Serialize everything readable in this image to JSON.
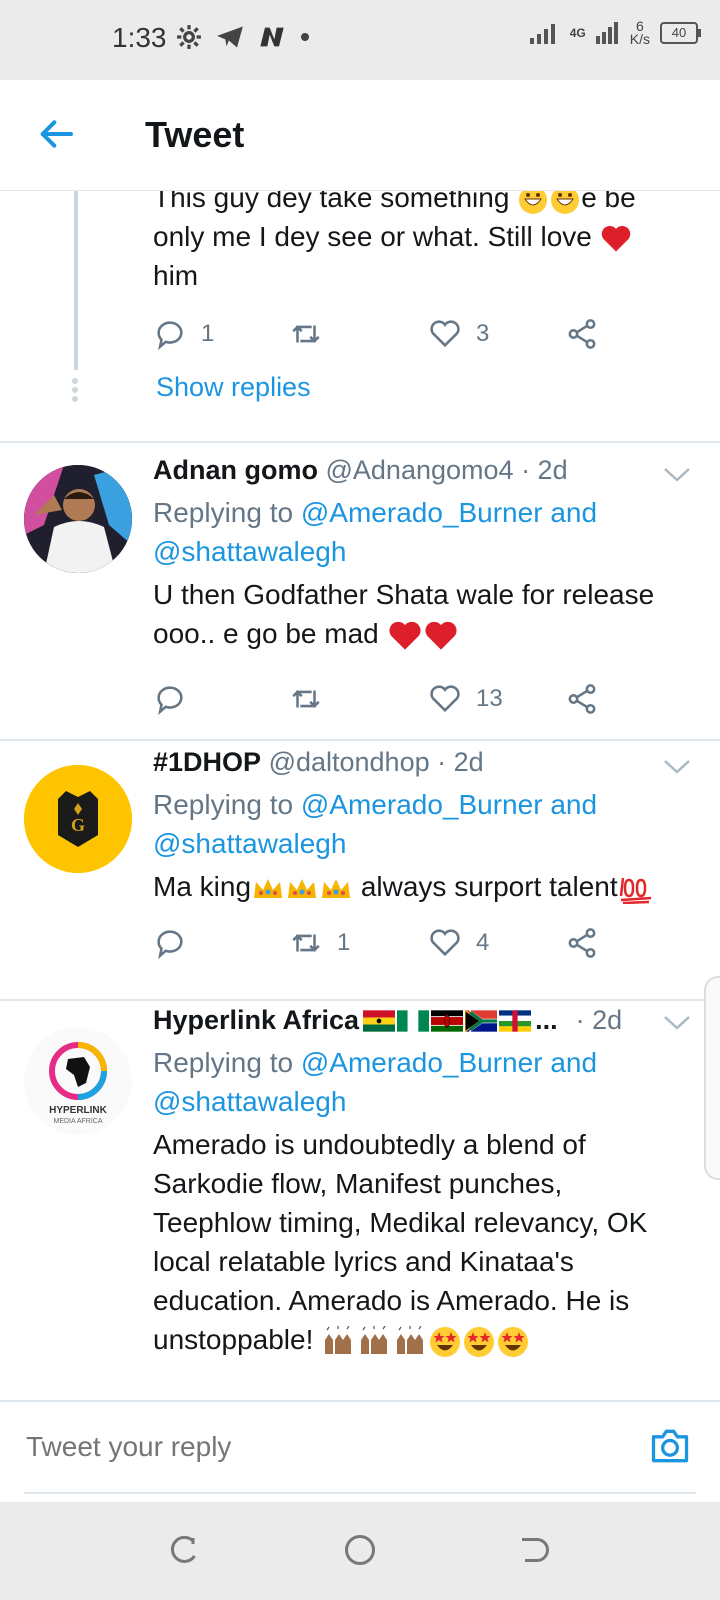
{
  "status_bar": {
    "time": "1:33",
    "network": "4G",
    "speed_value": "6",
    "speed_unit": "K/s",
    "battery": "40"
  },
  "header": {
    "title": "Tweet"
  },
  "partial_tweet": {
    "text_line1": "This guy dey take something",
    "text_line1_after": "e be",
    "text_line2": "only me I dey see or what. Still love",
    "text_line3": "him",
    "reply_count": "1",
    "retweet_count": "",
    "like_count": "3",
    "show_replies": "Show replies"
  },
  "tweets": [
    {
      "name": "Adnan gomo",
      "handle": "@Adnangomo4",
      "time": "· 2d",
      "replying_prefix": "Replying to",
      "replying_to_1": "@Amerado_Burner",
      "replying_and": "and",
      "replying_to_2": "@shattawalegh",
      "text_line1": "U then Godfather Shata wale for release",
      "text_line2": "ooo.. e go be mad",
      "reply_count": "",
      "retweet_count": "",
      "like_count": "13"
    },
    {
      "name": "#1DHOP",
      "handle": "@daltondhop",
      "time": "· 2d",
      "replying_prefix": "Replying to",
      "replying_to_1": "@Amerado_Burner",
      "replying_and": "and",
      "replying_to_2": "@shattawalegh",
      "text_line1_a": "Ma king",
      "text_line1_b": "always surport talent",
      "reply_count": "",
      "retweet_count": "1",
      "like_count": "4"
    },
    {
      "name": "Hyperlink Africa",
      "name_suffix": "...",
      "handle": "",
      "time": "· 2d",
      "replying_prefix": "Replying to",
      "replying_to_1": "@Amerado_Burner",
      "replying_and": "and",
      "replying_to_2": "@shattawalegh",
      "text": "Amerado is undoubtedly a blend of Sarkodie flow, Manifest punches, Teephlow timing, Medikal relevancy, OK local relatable lyrics and Kinataa's education. Amerado is Amerado.  He is unstoppable!",
      "avatar_text_1": "HYPERLINK",
      "avatar_text_2": "MEDIA AFRICA"
    }
  ],
  "reply_bar": {
    "placeholder": "Tweet your reply"
  },
  "colors": {
    "accent": "#1b95e0",
    "muted": "#657786",
    "divider": "#e1e8ed"
  }
}
